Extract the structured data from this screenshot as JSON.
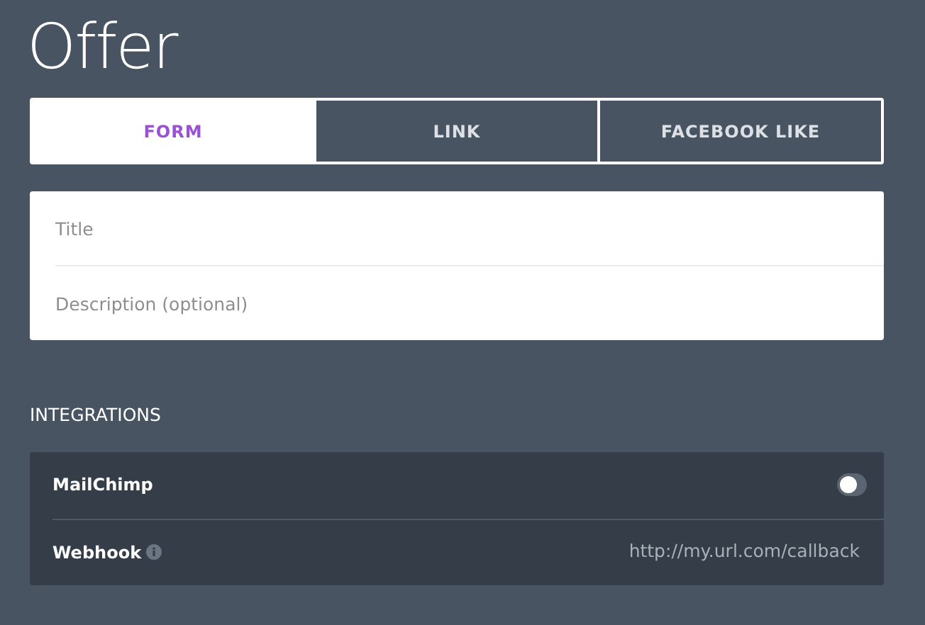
{
  "title": "Offer",
  "tabs": [
    {
      "label": "FORM",
      "selected": true
    },
    {
      "label": "LINK",
      "selected": false
    },
    {
      "label": "FACEBOOK LIKE",
      "selected": false
    }
  ],
  "form": {
    "fields": [
      {
        "placeholder": "Title"
      },
      {
        "placeholder": "Description (optional)"
      }
    ]
  },
  "integrations": {
    "heading": "INTEGRATIONS",
    "items": [
      {
        "kind": "toggle",
        "label": "MailChimp",
        "on": false
      },
      {
        "kind": "url",
        "label": "Webhook",
        "placeholder": "http://my.url.com/callback"
      }
    ]
  }
}
